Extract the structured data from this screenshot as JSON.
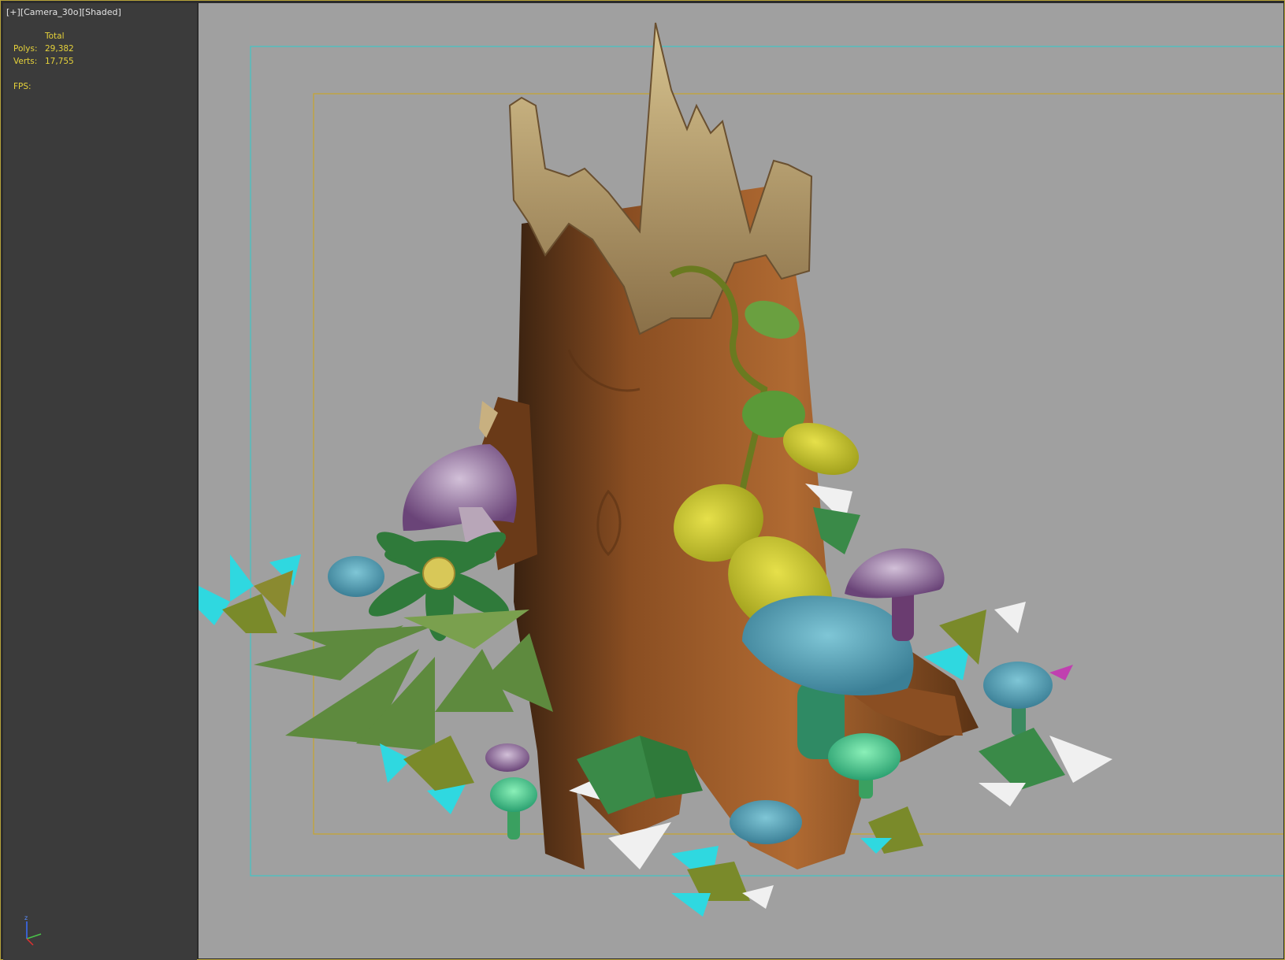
{
  "viewport": {
    "label_plus": "[+]",
    "label_camera": "[Camera_30o]",
    "label_shading": "[Shaded]"
  },
  "stats": {
    "total_label": "Total",
    "polys_label": "Polys:",
    "polys_value": "29,382",
    "verts_label": "Verts:",
    "verts_value": "17,755",
    "fps_label": "FPS:"
  },
  "axis": {
    "z_label": "z"
  },
  "colors": {
    "viewport_bg": "#a0a0a0",
    "panel_bg": "#3b3b3b",
    "stats_text": "#e6d23a",
    "safe_frame_cyan": "#3fc6c6",
    "safe_frame_yellow": "#c8a52c",
    "border_yellow": "#b8a43a"
  }
}
